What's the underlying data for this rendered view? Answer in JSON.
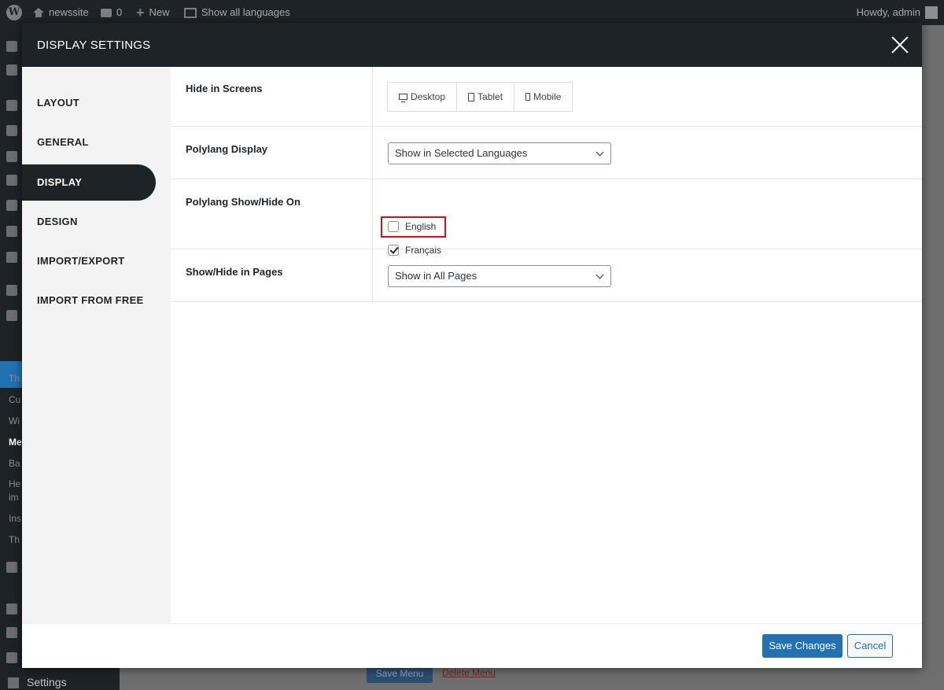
{
  "adminbar": {
    "site_name": "newssite",
    "comments_count": "0",
    "new_label": "New",
    "languages_label": "Show all languages",
    "howdy": "Howdy, admin"
  },
  "wp_sidebar": {
    "items": [
      "Th",
      "Cu",
      "Wi",
      "Me",
      "Ba",
      "He",
      "im",
      "Ins",
      "Th"
    ],
    "settings_label": "Settings"
  },
  "background": {
    "save_menu": "Save Menu",
    "delete_menu": "Delete Menu"
  },
  "modal": {
    "title": "DISPLAY SETTINGS",
    "nav": [
      "LAYOUT",
      "GENERAL",
      "DISPLAY",
      "DESIGN",
      "IMPORT/EXPORT",
      "IMPORT FROM FREE"
    ],
    "active_nav": "DISPLAY",
    "hide_in_screens": {
      "label": "Hide in Screens",
      "options": [
        "Desktop",
        "Tablet",
        "Mobile"
      ]
    },
    "polylang_display": {
      "label": "Polylang Display",
      "value": "Show in Selected Languages"
    },
    "polylang_show_hide": {
      "label": "Polylang Show/Hide On",
      "languages": [
        {
          "name": "English",
          "checked": false
        },
        {
          "name": "Français",
          "checked": true
        }
      ]
    },
    "show_hide_pages": {
      "label": "Show/Hide in Pages",
      "value": "Show in All Pages"
    },
    "save_label": "Save Changes",
    "cancel_label": "Cancel"
  },
  "colors": {
    "accent": "#2271b1",
    "dark": "#1d2327",
    "highlight": "#d0131a"
  }
}
